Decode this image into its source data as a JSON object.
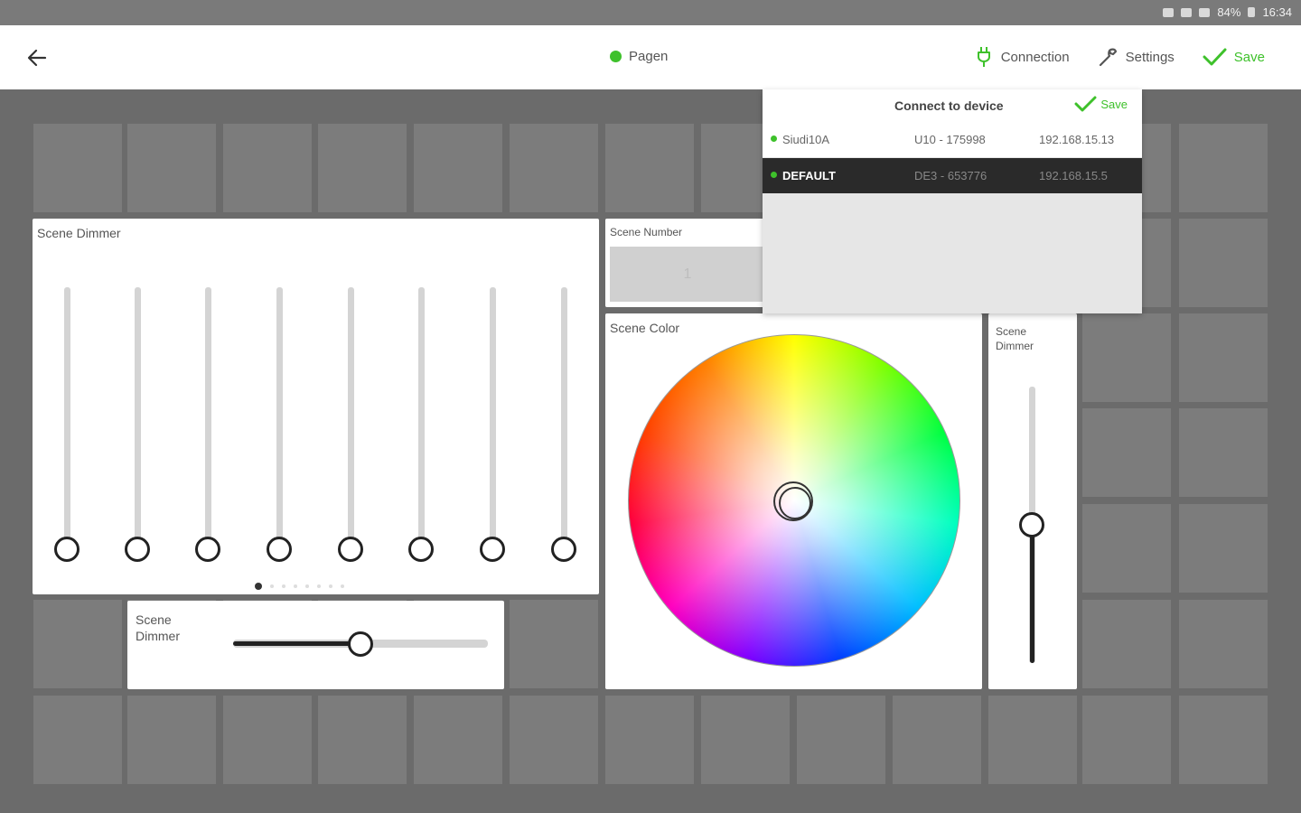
{
  "status_bar": {
    "battery": "84%",
    "time": "16:34"
  },
  "toolbar": {
    "title": "Pagen",
    "connection_label": "Connection",
    "settings_label": "Settings",
    "save_label": "Save",
    "accent": "#3ec12b"
  },
  "popup": {
    "title": "Connect to device",
    "save_label": "Save",
    "devices": [
      {
        "name": "Siudi10A",
        "id": "U10 - 175998",
        "ip": "192.168.15.13",
        "selected": false
      },
      {
        "name": "DEFAULT",
        "id": "DE3 - 653776",
        "ip": "192.168.15.5",
        "selected": true
      }
    ]
  },
  "widgets": {
    "dimmer_multi": {
      "title": "Scene Dimmer",
      "slider_levels": [
        0,
        0,
        0,
        0,
        0,
        0,
        0,
        0
      ],
      "page_count": 8,
      "current_page": 1
    },
    "dimmer_horizontal": {
      "title": "Scene Dimmer",
      "level": 0.5
    },
    "scene_number": {
      "title": "Scene Number",
      "value": "1"
    },
    "scene_color": {
      "title": "Scene Color"
    },
    "dimmer_vertical": {
      "title": "Scene Dimmer",
      "level": 0.5
    }
  }
}
